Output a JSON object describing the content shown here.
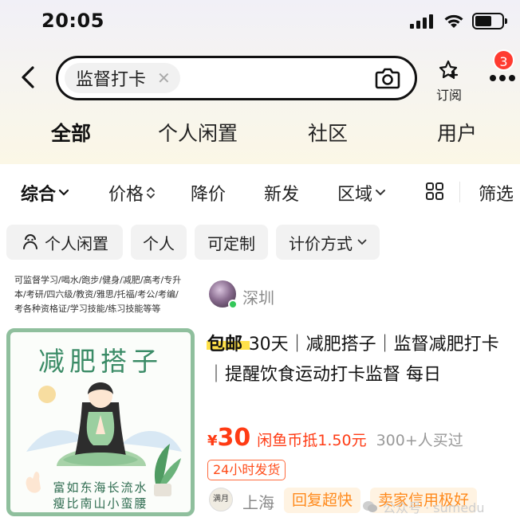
{
  "status_bar": {
    "time": "20:05",
    "battery_level": 0.62
  },
  "search": {
    "keyword": "监督打卡",
    "clear_icon": "close-icon",
    "camera_icon": "camera-icon"
  },
  "header": {
    "subscribe_label": "订阅",
    "notification_count": "3"
  },
  "category_tabs": [
    {
      "label": "全部",
      "active": true
    },
    {
      "label": "个人闲置",
      "active": false
    },
    {
      "label": "社区",
      "active": false
    },
    {
      "label": "用户",
      "active": false
    }
  ],
  "sort_bar": {
    "items": [
      {
        "label": "综合",
        "active": true,
        "icon": "chevron-down-icon"
      },
      {
        "label": "价格",
        "active": false,
        "icon": "sort-updown-icon"
      },
      {
        "label": "降价",
        "active": false
      },
      {
        "label": "新发",
        "active": false
      },
      {
        "label": "区域",
        "active": false,
        "icon": "chevron-down-icon"
      }
    ],
    "filter_label": "筛选"
  },
  "filter_chips": [
    {
      "label": "个人闲置",
      "icon": "person-icon"
    },
    {
      "label": "个人"
    },
    {
      "label": "可定制"
    },
    {
      "label": "计价方式",
      "icon": "chevron-down-icon"
    }
  ],
  "previous_item": {
    "snippet_line1": "可监督学习/喝水/跑步/健身/减肥/高考/专升",
    "snippet_line2": "本/考研/四六级/教资/雅思/托福/考公/考编/",
    "snippet_line3": "考各种资格证/学习技能/练习技能等等",
    "location": "深圳"
  },
  "product": {
    "thumbnail": {
      "title": "减肥搭子",
      "line1": "富如东海长流水",
      "line2": "瘦比南山小蛮腰"
    },
    "free_shipping": "包邮",
    "title": "30天｜减肥搭子｜监督减肥打卡｜提醒饮食运动打卡监督 每日",
    "price_symbol": "¥",
    "price": "30",
    "coin_deduct": "闲鱼币抵1.50元",
    "bought": "300+人买过",
    "ship_tag": "24小时发货",
    "seller_avatar_text": "满月",
    "location": "上海",
    "tags": [
      "回复超快",
      "卖家信用极好"
    ]
  },
  "watermark": {
    "text": "公众号 · sumedu"
  },
  "colors": {
    "accent_yellow": "#ffe14a",
    "price_red": "#ff3b14",
    "tag_orange": "#ff8a1c",
    "thumb_green": "#8fbf9d"
  }
}
